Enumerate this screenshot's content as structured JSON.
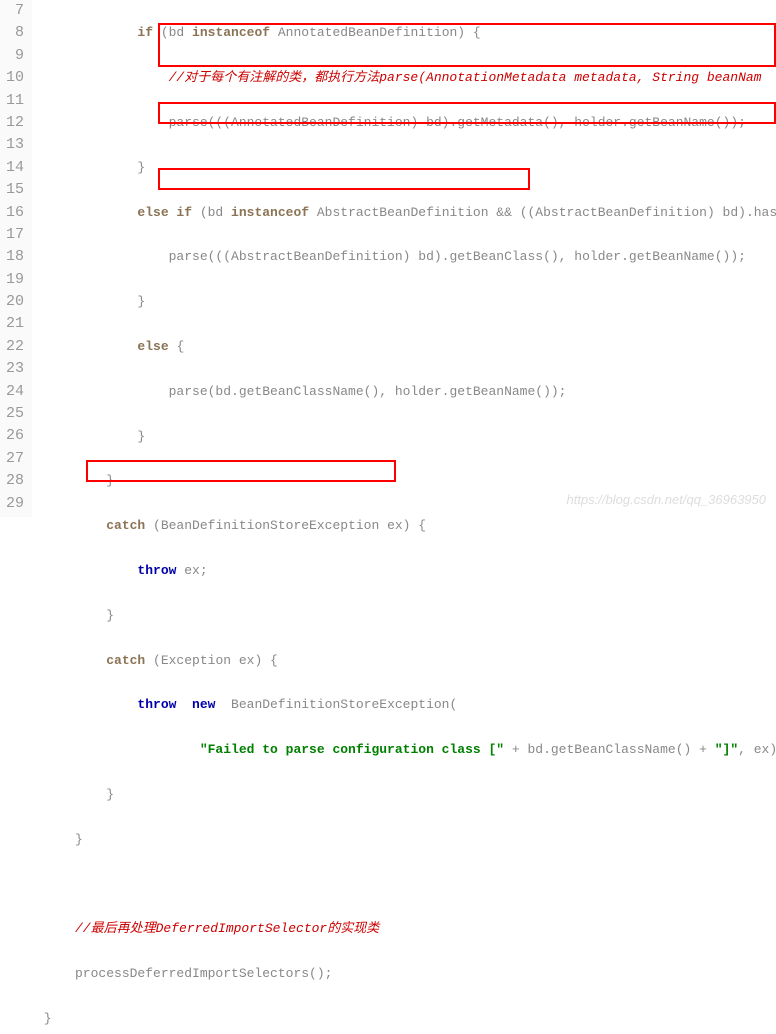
{
  "lineNumbers": [
    "7",
    "8",
    "9",
    "10",
    "11",
    "12",
    "13",
    "14",
    "15",
    "16",
    "17",
    "18",
    "19",
    "20",
    "21",
    "22",
    "23",
    "24",
    "25",
    "26",
    "27",
    "28",
    "29"
  ],
  "l7a": "             if ",
  "l7b": "(bd ",
  "l7c": "instanceof ",
  "l7d": "AnnotatedBeanDefinition) {",
  "l8": "                 //对于每个有注解的类，都执行方法parse(AnnotationMetadata metadata, String beanNam",
  "l9": "                 parse(((AnnotatedBeanDefinition) bd).getMetadata(), holder.getBeanName());",
  "l10": "             }",
  "l11a": "             else if ",
  "l11b": "(bd ",
  "l11c": "instanceof ",
  "l11d": "AbstractBeanDefinition && ((AbstractBeanDefinition) bd).hasB",
  "l12": "                 parse(((AbstractBeanDefinition) bd).getBeanClass(), holder.getBeanName());",
  "l13": "             }",
  "l14a": "             else ",
  "l14b": "{",
  "l15": "                 parse(bd.getBeanClassName(), holder.getBeanName());",
  "l16": "             }",
  "l17": "         }",
  "l18a": "         catch ",
  "l18b": "(BeanDefinitionStoreException ex) {",
  "l19a": "             throw ",
  "l19b": "ex;",
  "l20": "         }",
  "l21a": "         catch ",
  "l21b": "(Exception ex) {",
  "l22a": "             throw  new  ",
  "l22b": "BeanDefinitionStoreException(",
  "l23a": "                     ",
  "l23b": "\"Failed to parse configuration class [\"",
  "l23c": " + bd.getBeanClassName() + ",
  "l23d": "\"]\"",
  "l23e": ", ex);",
  "l24": "         }",
  "l25": "     }",
  "l26": "",
  "l27": "     //最后再处理DeferredImportSelector的实现类",
  "l28": "     processDeferredImportSelectors();",
  "l29": " }",
  "watermark": "https://blog.csdn.net/qq_36963950"
}
